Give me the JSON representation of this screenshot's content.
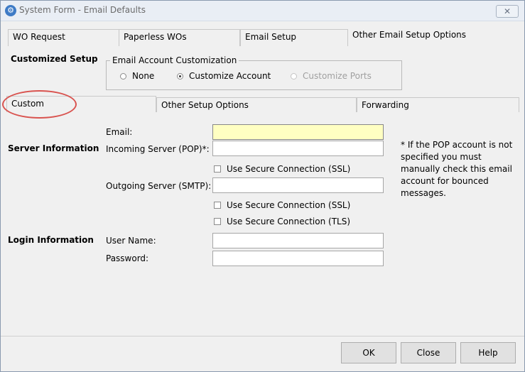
{
  "window": {
    "title": "System Form - Email Defaults",
    "close_label": "✕",
    "app_icon": "gear-icon"
  },
  "main_tabs": [
    {
      "label": "WO Request",
      "active": false
    },
    {
      "label": "Paperless WOs",
      "active": false
    },
    {
      "label": "Email Setup",
      "active": false
    },
    {
      "label": "Other Email Setup Options",
      "active": true
    }
  ],
  "customized_setup": {
    "label": "Customized Setup",
    "group_title": "Email Account Customization",
    "options": [
      {
        "label": "None",
        "selected": false,
        "enabled": true
      },
      {
        "label": "Customize Account",
        "selected": true,
        "enabled": true
      },
      {
        "label": "Customize Ports",
        "selected": false,
        "enabled": false
      }
    ]
  },
  "sub_tabs": [
    {
      "label": "Custom",
      "active": true
    },
    {
      "label": "Other Setup Options",
      "active": false
    },
    {
      "label": "Forwarding",
      "active": false
    }
  ],
  "server_info": {
    "section_label": "Server Information",
    "email_label": "Email:",
    "email_value": "",
    "incoming_label": "Incoming Server (POP)*:",
    "incoming_value": "",
    "incoming_ssl_label": "Use Secure Connection (SSL)",
    "outgoing_label": "Outgoing Server (SMTP):",
    "outgoing_value": "",
    "outgoing_ssl_label": "Use Secure Connection (SSL)",
    "outgoing_tls_label": "Use Secure Connection (TLS)"
  },
  "login_info": {
    "section_label": "Login Information",
    "username_label": "User Name:",
    "username_value": "",
    "password_label": "Password:",
    "password_value": ""
  },
  "note": "* If the POP account is not specified you must manually check this email account for bounced messages.",
  "buttons": {
    "ok": "OK",
    "close": "Close",
    "help": "Help"
  },
  "colors": {
    "email_highlight": "#ffffc2",
    "annotation": "#d9534f"
  }
}
